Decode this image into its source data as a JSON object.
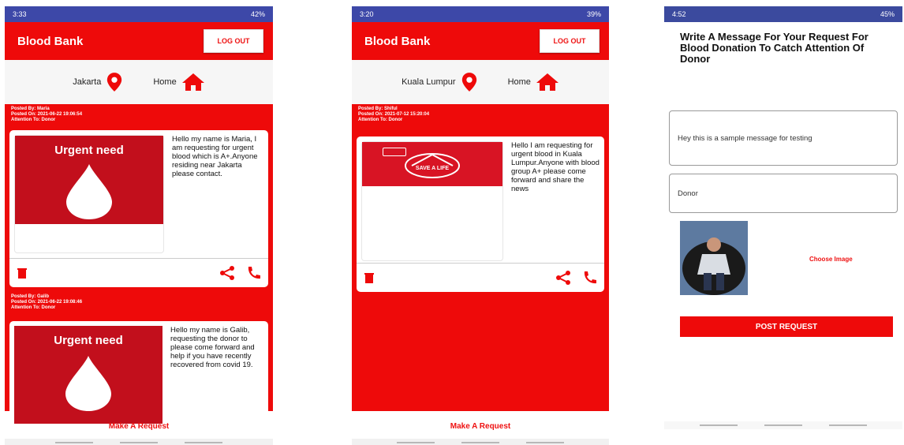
{
  "colors": {
    "accent": "#ee0a0a",
    "status_bar": "#3d48a8",
    "urgent_bg": "#c20f1c"
  },
  "screen1": {
    "status_time": "3:33",
    "status_right": "42%",
    "app_title": "Blood Bank",
    "logout": "LOG OUT",
    "location": "Jakarta",
    "home": "Home",
    "posts": [
      {
        "meta": [
          "Posted By: Maria",
          "Posted On: 2021-06-22 19:06:54",
          "Attention To: Donor"
        ],
        "image_text": "Urgent need",
        "text": "Hello my name is Maria, I am requesting for urgent blood which is A+.Anyone residing near Jakarta please contact."
      },
      {
        "meta": [
          "Posted By: Galib",
          "Posted On: 2021-06-22 19:08:46",
          "Attention To: Donor"
        ],
        "image_text": "Urgent need",
        "text": "Hello my name is Galib, requesting the donor to please come forward and help if you have recently recovered from covid 19."
      }
    ],
    "make_request": "Make A Request"
  },
  "screen2": {
    "status_time": "3:20",
    "status_right": "39%",
    "app_title": "Blood Bank",
    "logout": "LOG OUT",
    "location": "Kuala Lumpur",
    "home": "Home",
    "post": {
      "meta": [
        "Posted By: Shiful",
        "Posted On: 2021-07-12 15:20:04",
        "Attention To: Donor"
      ],
      "image_text": "SAVE A LIFE",
      "text": "Hello I am requesting for urgent blood in Kuala Lumpur.Anyone with blood group A+ please come forward and share the news"
    },
    "make_request": "Make A Request"
  },
  "screen3": {
    "status_time": "4:52",
    "status_right": "45%",
    "title": "Write A Message For Your Request For Blood Donation To Catch Attention Of Donor",
    "message_value": "Hey this is a sample message for testing",
    "attention_value": "Donor",
    "choose_image": "Choose Image",
    "post_request": "POST REQUEST"
  },
  "icons": [
    "location-pin-icon",
    "home-icon",
    "delete-icon",
    "share-icon",
    "phone-icon"
  ]
}
